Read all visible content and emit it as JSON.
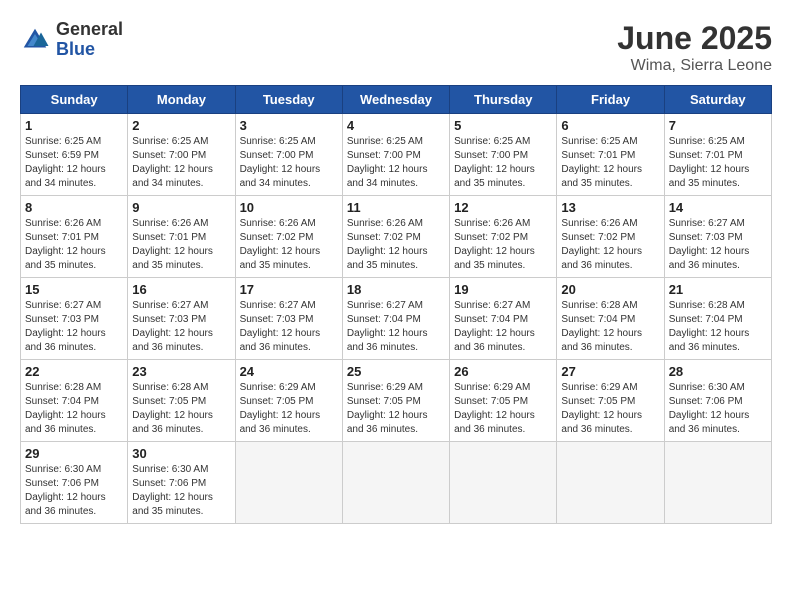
{
  "logo": {
    "general": "General",
    "blue": "Blue"
  },
  "title": "June 2025",
  "location": "Wima, Sierra Leone",
  "days_of_week": [
    "Sunday",
    "Monday",
    "Tuesday",
    "Wednesday",
    "Thursday",
    "Friday",
    "Saturday"
  ],
  "weeks": [
    [
      {
        "day": "1",
        "sunrise": "6:25 AM",
        "sunset": "6:59 PM",
        "daylight": "12 hours and 34 minutes."
      },
      {
        "day": "2",
        "sunrise": "6:25 AM",
        "sunset": "7:00 PM",
        "daylight": "12 hours and 34 minutes."
      },
      {
        "day": "3",
        "sunrise": "6:25 AM",
        "sunset": "7:00 PM",
        "daylight": "12 hours and 34 minutes."
      },
      {
        "day": "4",
        "sunrise": "6:25 AM",
        "sunset": "7:00 PM",
        "daylight": "12 hours and 34 minutes."
      },
      {
        "day": "5",
        "sunrise": "6:25 AM",
        "sunset": "7:00 PM",
        "daylight": "12 hours and 35 minutes."
      },
      {
        "day": "6",
        "sunrise": "6:25 AM",
        "sunset": "7:01 PM",
        "daylight": "12 hours and 35 minutes."
      },
      {
        "day": "7",
        "sunrise": "6:25 AM",
        "sunset": "7:01 PM",
        "daylight": "12 hours and 35 minutes."
      }
    ],
    [
      {
        "day": "8",
        "sunrise": "6:26 AM",
        "sunset": "7:01 PM",
        "daylight": "12 hours and 35 minutes."
      },
      {
        "day": "9",
        "sunrise": "6:26 AM",
        "sunset": "7:01 PM",
        "daylight": "12 hours and 35 minutes."
      },
      {
        "day": "10",
        "sunrise": "6:26 AM",
        "sunset": "7:02 PM",
        "daylight": "12 hours and 35 minutes."
      },
      {
        "day": "11",
        "sunrise": "6:26 AM",
        "sunset": "7:02 PM",
        "daylight": "12 hours and 35 minutes."
      },
      {
        "day": "12",
        "sunrise": "6:26 AM",
        "sunset": "7:02 PM",
        "daylight": "12 hours and 35 minutes."
      },
      {
        "day": "13",
        "sunrise": "6:26 AM",
        "sunset": "7:02 PM",
        "daylight": "12 hours and 36 minutes."
      },
      {
        "day": "14",
        "sunrise": "6:27 AM",
        "sunset": "7:03 PM",
        "daylight": "12 hours and 36 minutes."
      }
    ],
    [
      {
        "day": "15",
        "sunrise": "6:27 AM",
        "sunset": "7:03 PM",
        "daylight": "12 hours and 36 minutes."
      },
      {
        "day": "16",
        "sunrise": "6:27 AM",
        "sunset": "7:03 PM",
        "daylight": "12 hours and 36 minutes."
      },
      {
        "day": "17",
        "sunrise": "6:27 AM",
        "sunset": "7:03 PM",
        "daylight": "12 hours and 36 minutes."
      },
      {
        "day": "18",
        "sunrise": "6:27 AM",
        "sunset": "7:04 PM",
        "daylight": "12 hours and 36 minutes."
      },
      {
        "day": "19",
        "sunrise": "6:27 AM",
        "sunset": "7:04 PM",
        "daylight": "12 hours and 36 minutes."
      },
      {
        "day": "20",
        "sunrise": "6:28 AM",
        "sunset": "7:04 PM",
        "daylight": "12 hours and 36 minutes."
      },
      {
        "day": "21",
        "sunrise": "6:28 AM",
        "sunset": "7:04 PM",
        "daylight": "12 hours and 36 minutes."
      }
    ],
    [
      {
        "day": "22",
        "sunrise": "6:28 AM",
        "sunset": "7:04 PM",
        "daylight": "12 hours and 36 minutes."
      },
      {
        "day": "23",
        "sunrise": "6:28 AM",
        "sunset": "7:05 PM",
        "daylight": "12 hours and 36 minutes."
      },
      {
        "day": "24",
        "sunrise": "6:29 AM",
        "sunset": "7:05 PM",
        "daylight": "12 hours and 36 minutes."
      },
      {
        "day": "25",
        "sunrise": "6:29 AM",
        "sunset": "7:05 PM",
        "daylight": "12 hours and 36 minutes."
      },
      {
        "day": "26",
        "sunrise": "6:29 AM",
        "sunset": "7:05 PM",
        "daylight": "12 hours and 36 minutes."
      },
      {
        "day": "27",
        "sunrise": "6:29 AM",
        "sunset": "7:05 PM",
        "daylight": "12 hours and 36 minutes."
      },
      {
        "day": "28",
        "sunrise": "6:30 AM",
        "sunset": "7:06 PM",
        "daylight": "12 hours and 36 minutes."
      }
    ],
    [
      {
        "day": "29",
        "sunrise": "6:30 AM",
        "sunset": "7:06 PM",
        "daylight": "12 hours and 36 minutes."
      },
      {
        "day": "30",
        "sunrise": "6:30 AM",
        "sunset": "7:06 PM",
        "daylight": "12 hours and 35 minutes."
      },
      null,
      null,
      null,
      null,
      null
    ]
  ]
}
